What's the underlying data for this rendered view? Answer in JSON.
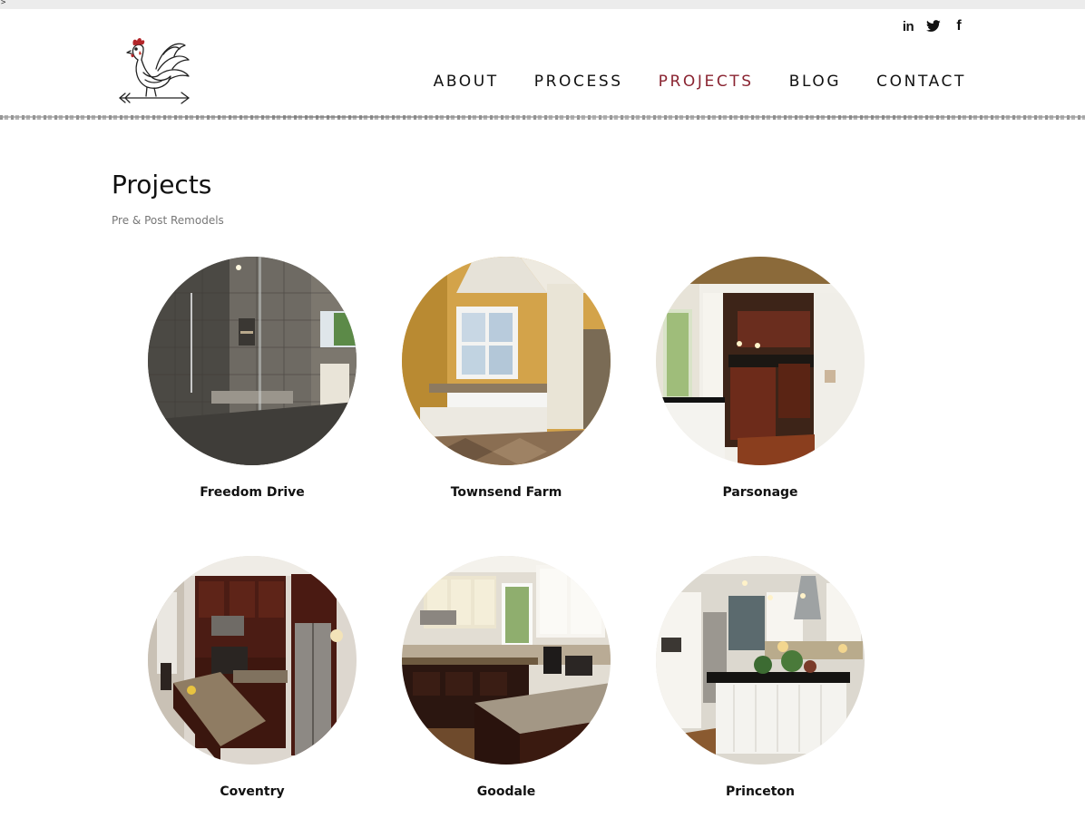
{
  "browser": {
    "caret": ">"
  },
  "social": [
    {
      "name": "linkedin-icon",
      "glyph": "in"
    },
    {
      "name": "twitter-icon"
    },
    {
      "name": "facebook-icon",
      "glyph": "f"
    }
  ],
  "nav": {
    "items": [
      {
        "label": "ABOUT"
      },
      {
        "label": "PROCESS"
      },
      {
        "label": "PROJECTS",
        "active": true
      },
      {
        "label": "BLOG"
      },
      {
        "label": "CONTACT"
      }
    ],
    "active_color": "#8a2431"
  },
  "page": {
    "title": "Projects",
    "subtitle": "Pre & Post Remodels"
  },
  "projects": [
    {
      "label": "Freedom Drive",
      "image": "tiled-shower-photo"
    },
    {
      "label": "Townsend Farm",
      "image": "bathtub-room-photo"
    },
    {
      "label": "Parsonage",
      "image": "kitchen-with-column-photo"
    },
    {
      "label": "Coventry",
      "image": "dark-cherry-kitchen-photo"
    },
    {
      "label": "Goodale",
      "image": "granite-kitchen-photo"
    },
    {
      "label": "Princeton",
      "image": "white-island-kitchen-photo"
    }
  ]
}
